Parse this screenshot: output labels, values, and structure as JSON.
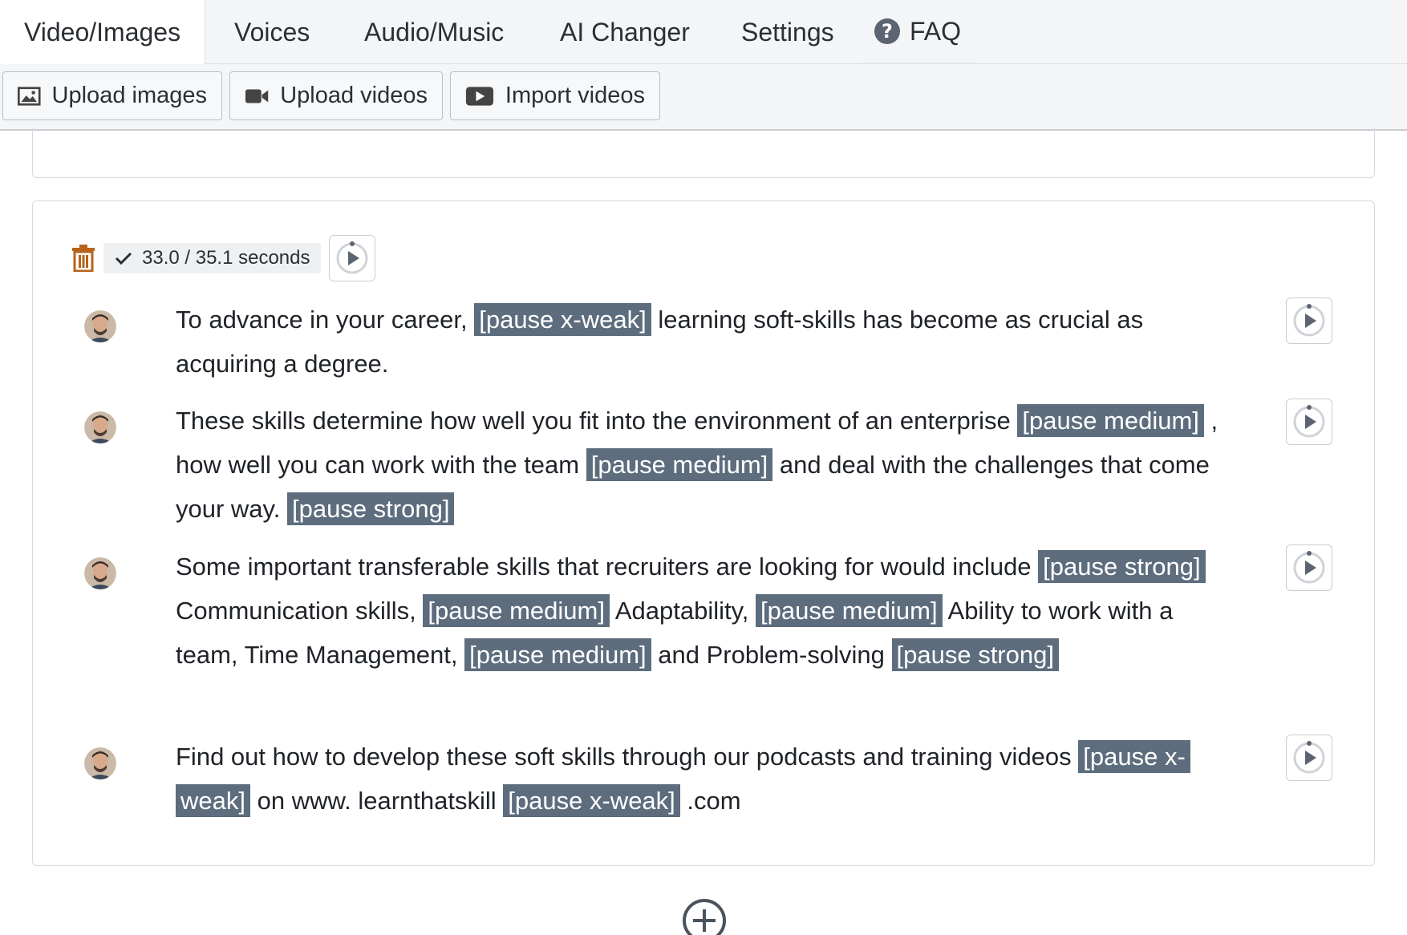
{
  "tabs": [
    {
      "label": "Video/Images",
      "active": true
    },
    {
      "label": "Voices",
      "active": false
    },
    {
      "label": "Audio/Music",
      "active": false
    },
    {
      "label": "AI Changer",
      "active": false
    },
    {
      "label": "Settings",
      "active": false
    },
    {
      "label": "FAQ",
      "active": false,
      "icon": "help-circle-icon"
    }
  ],
  "toolbar": {
    "upload_images": "Upload images",
    "upload_videos": "Upload videos",
    "import_videos": "Import videos"
  },
  "scene": {
    "duration": "33.0 / 35.1 seconds",
    "sentences": [
      {
        "parts": [
          {
            "text": "To advance in your career, "
          },
          {
            "text": "[pause x-weak]",
            "tag": true
          },
          {
            "text": "  learning soft-skills has become as crucial as acquiring a degree."
          }
        ]
      },
      {
        "parts": [
          {
            "text": "These skills determine how well you fit into the environment of an enterprise "
          },
          {
            "text": "[pause medium]",
            "tag": true
          },
          {
            "text": " , how well you can work with the team  "
          },
          {
            "text": "[pause medium]",
            "tag": true
          },
          {
            "text": " and deal with the challenges that come your way.  "
          },
          {
            "text": "[pause strong]",
            "tag": true
          }
        ]
      },
      {
        "parts": [
          {
            "text": "Some important transferable skills that recruiters are looking for would include "
          },
          {
            "text": "[pause strong]",
            "tag": true
          },
          {
            "text": "  Communication skills, "
          },
          {
            "text": "[pause medium]",
            "tag": true
          },
          {
            "text": "  Adaptability, "
          },
          {
            "text": "[pause medium]",
            "tag": true
          },
          {
            "text": "  Ability to work with a team, Time Management,  "
          },
          {
            "text": "[pause medium]",
            "tag": true
          },
          {
            "text": " and Problem-solving  "
          },
          {
            "text": "[pause strong]",
            "tag": true
          }
        ]
      },
      {
        "parts": [
          {
            "text": "Find out how to develop these soft skills through our podcasts and training videos "
          },
          {
            "text": "[pause x-weak]",
            "tag": true
          },
          {
            "text": "  on www. learnthatskill "
          },
          {
            "text": "[pause x-weak]",
            "tag": true
          },
          {
            "text": " .com"
          }
        ]
      }
    ]
  },
  "colors": {
    "pause_tag_bg": "#5d6d7e",
    "trash": "#b8621b",
    "tab_bar_bg": "#f4f5f7"
  }
}
